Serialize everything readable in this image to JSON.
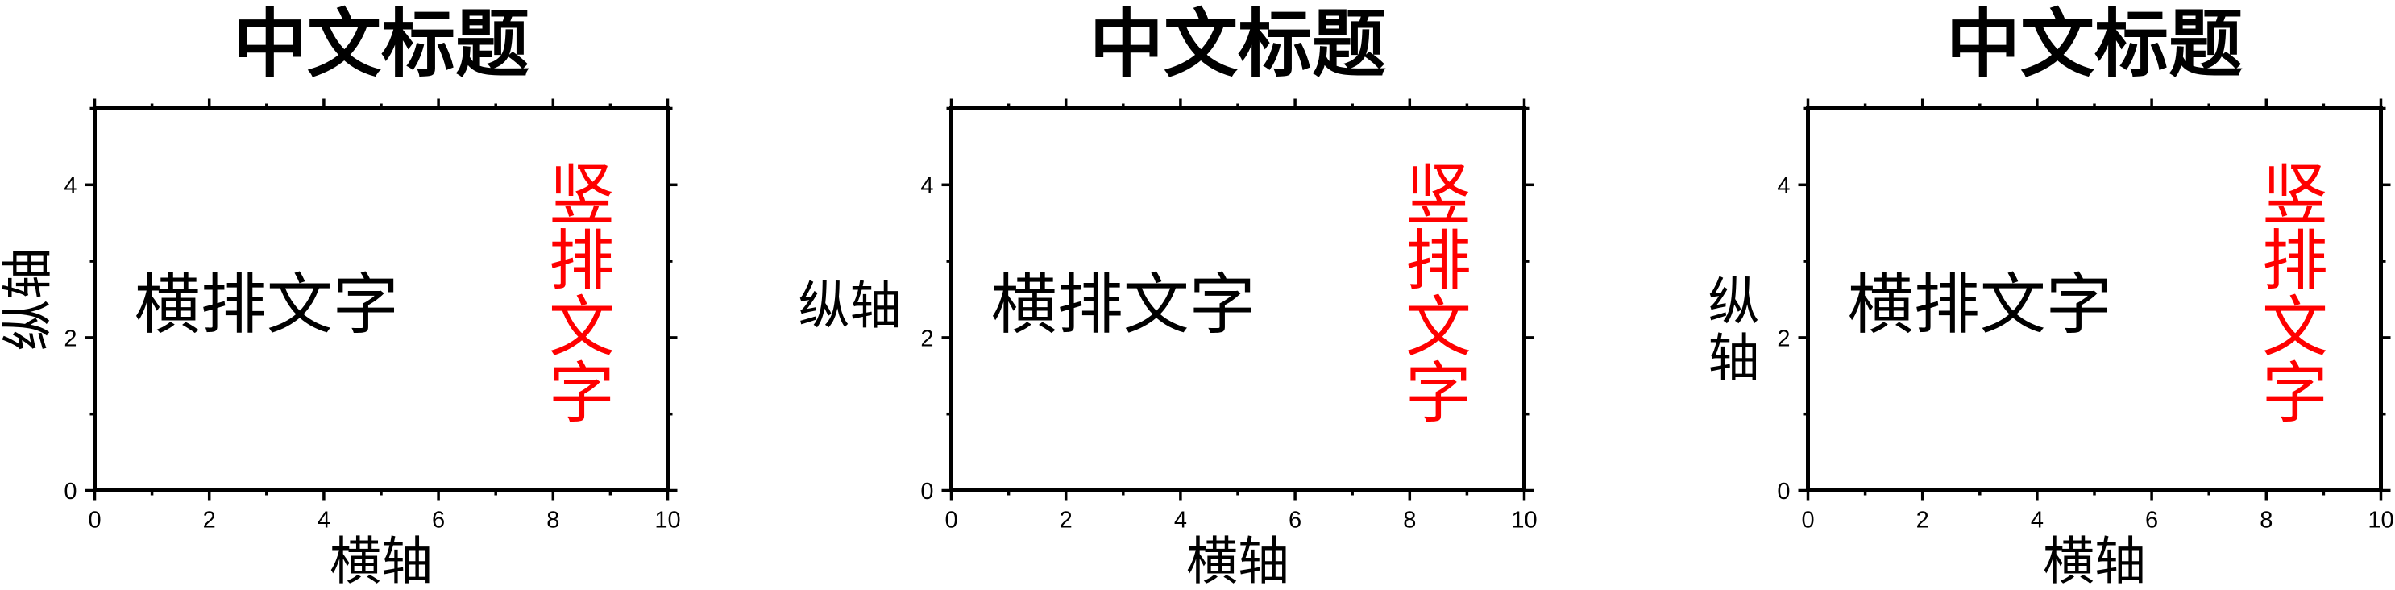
{
  "chart_data": [
    {
      "type": "scatter",
      "title": "中文标题",
      "xlabel": "横轴",
      "ylabel": "纵轴",
      "ylabel_orientation": "rotated",
      "xlim": [
        0,
        10
      ],
      "ylim": [
        0,
        5
      ],
      "x_ticks": [
        0,
        2,
        4,
        6,
        8,
        10
      ],
      "y_ticks": [
        0,
        2,
        4
      ],
      "x_minor_step": 1,
      "y_minor_step": 1,
      "grid": false,
      "series": [],
      "annotations": [
        {
          "text": "横排文字",
          "x": 3,
          "y": 2.5,
          "orientation": "horizontal",
          "color": "#000000"
        },
        {
          "text": "竖排文字",
          "x": 8.5,
          "y": 2.6,
          "orientation": "vertical",
          "color": "#ff0000"
        }
      ]
    },
    {
      "type": "scatter",
      "title": "中文标题",
      "xlabel": "横轴",
      "ylabel": "纵轴",
      "ylabel_orientation": "horizontal",
      "xlim": [
        0,
        10
      ],
      "ylim": [
        0,
        5
      ],
      "x_ticks": [
        0,
        2,
        4,
        6,
        8,
        10
      ],
      "y_ticks": [
        0,
        2,
        4
      ],
      "x_minor_step": 1,
      "y_minor_step": 1,
      "grid": false,
      "series": [],
      "annotations": [
        {
          "text": "横排文字",
          "x": 3,
          "y": 2.5,
          "orientation": "horizontal",
          "color": "#000000"
        },
        {
          "text": "竖排文字",
          "x": 8.5,
          "y": 2.6,
          "orientation": "vertical",
          "color": "#ff0000"
        }
      ]
    },
    {
      "type": "scatter",
      "title": "中文标题",
      "xlabel": "横轴",
      "ylabel": "纵轴",
      "ylabel_orientation": "vertical-stacked",
      "xlim": [
        0,
        10
      ],
      "ylim": [
        0,
        5
      ],
      "x_ticks": [
        0,
        2,
        4,
        6,
        8,
        10
      ],
      "y_ticks": [
        0,
        2,
        4
      ],
      "x_minor_step": 1,
      "y_minor_step": 1,
      "grid": false,
      "series": [],
      "annotations": [
        {
          "text": "横排文字",
          "x": 3,
          "y": 2.5,
          "orientation": "horizontal",
          "color": "#000000"
        },
        {
          "text": "竖排文字",
          "x": 8.5,
          "y": 2.6,
          "orientation": "vertical",
          "color": "#ff0000"
        }
      ]
    }
  ]
}
